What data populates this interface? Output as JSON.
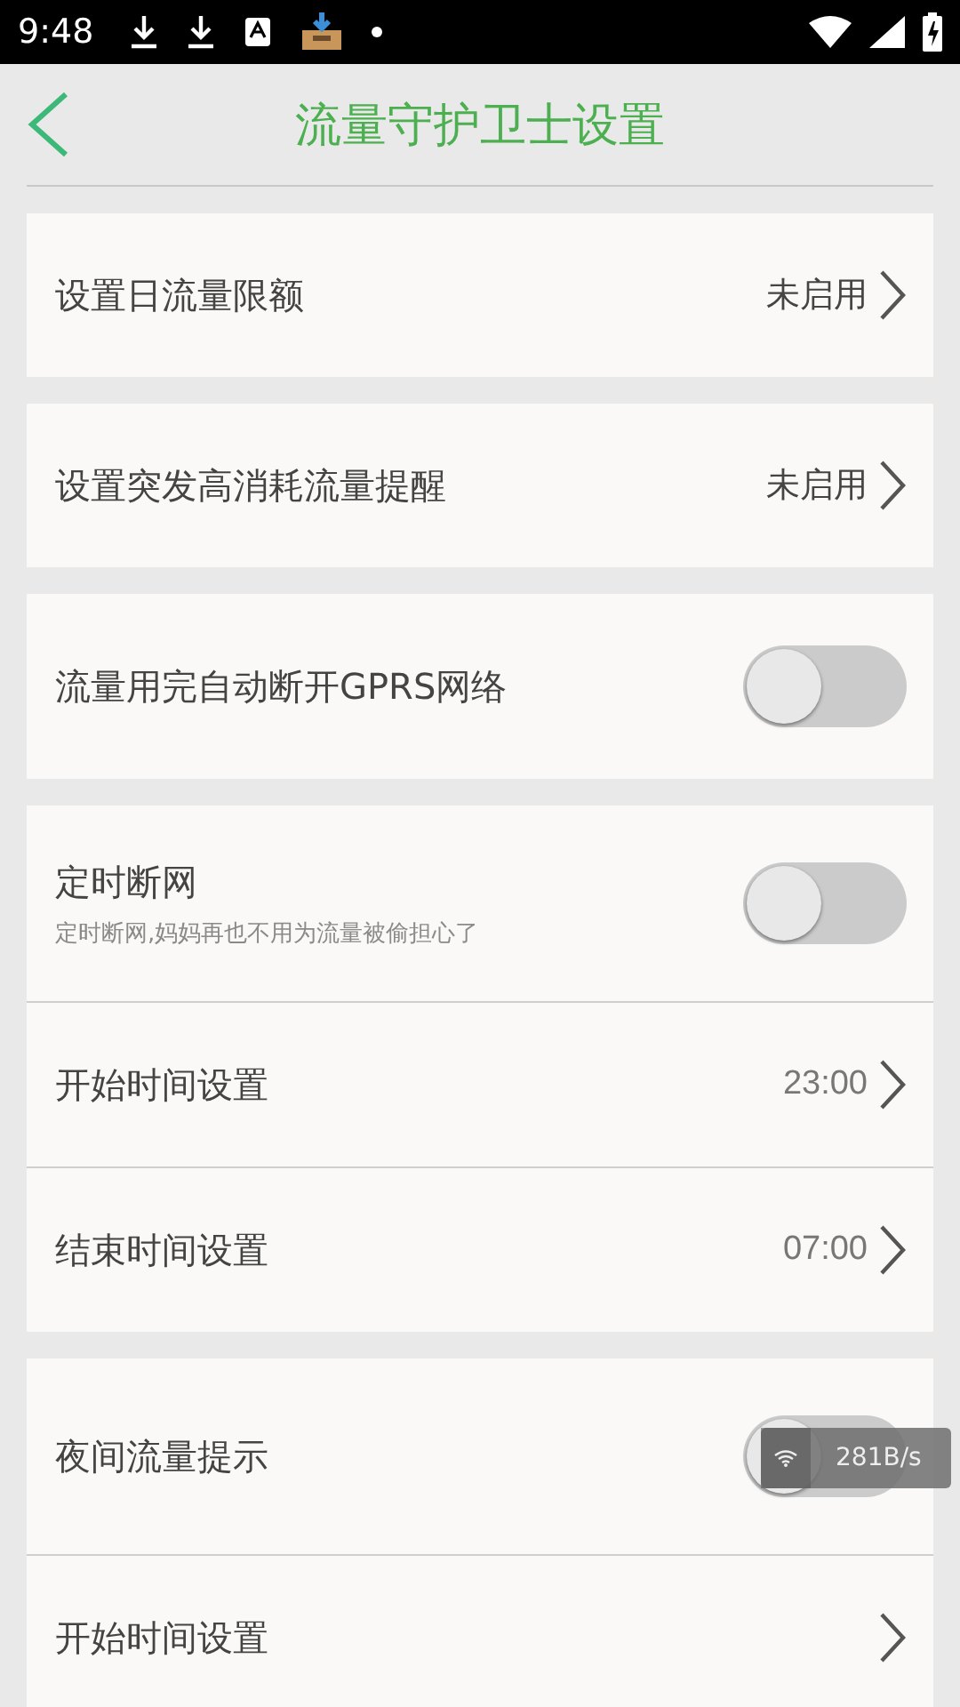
{
  "status_bar": {
    "time": "9:48"
  },
  "header": {
    "title": "流量守护卫士设置"
  },
  "groups": [
    {
      "rows": [
        {
          "kind": "link",
          "label": "设置日流量限额",
          "value": "未启用",
          "dimmed": false
        }
      ]
    },
    {
      "rows": [
        {
          "kind": "link",
          "label": "设置突发高消耗流量提醒",
          "value": "未启用",
          "dimmed": false
        }
      ]
    },
    {
      "rows": [
        {
          "kind": "toggle",
          "label": "流量用完自动断开GPRS网络",
          "on": false
        }
      ]
    },
    {
      "rows": [
        {
          "kind": "toggle",
          "label": "定时断网",
          "subtitle": "定时断网,妈妈再也不用为流量被偷担心了",
          "on": false
        },
        {
          "kind": "link",
          "label": "开始时间设置",
          "value": "23:00",
          "dimmed": true
        },
        {
          "kind": "link",
          "label": "结束时间设置",
          "value": "07:00",
          "dimmed": true
        }
      ]
    },
    {
      "rows": [
        {
          "kind": "toggle",
          "label": "夜间流量提示",
          "on": false
        },
        {
          "kind": "link",
          "label": "开始时间设置"
        }
      ]
    }
  ],
  "speed_overlay": {
    "reading": "281B/s"
  }
}
